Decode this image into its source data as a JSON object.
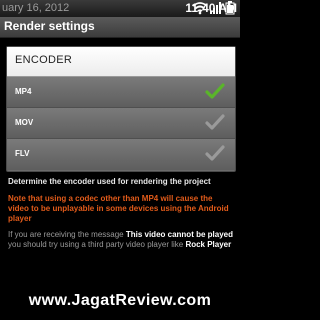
{
  "status_bar": {
    "date": "uary 16, 2012",
    "time": "11:40 AM",
    "icons": [
      "wifi-icon",
      "signal-icon",
      "battery-icon"
    ]
  },
  "title_bar": {
    "title": "Render settings"
  },
  "encoder": {
    "title": "ENCODER",
    "options": [
      {
        "label": "MP4",
        "selected": true
      },
      {
        "label": "MOV",
        "selected": false
      },
      {
        "label": "FLV",
        "selected": false
      }
    ]
  },
  "info": {
    "description": "Determine the encoder used for rendering the project",
    "note": "Note that using a codec other than MP4 will cause the video to be unplayable in some devices using the Android player",
    "msg_part1": "If you are receiving the message ",
    "msg_bold1": "This video cannot be played",
    "msg_part2": " you should try using a third party video player like ",
    "msg_bold2": "Rock Player"
  },
  "watermark": "www.JagatReview.com",
  "colors": {
    "check_selected": "#5ab52a",
    "check_unselected": "#9a9a9a",
    "note": "#e25b1a"
  }
}
